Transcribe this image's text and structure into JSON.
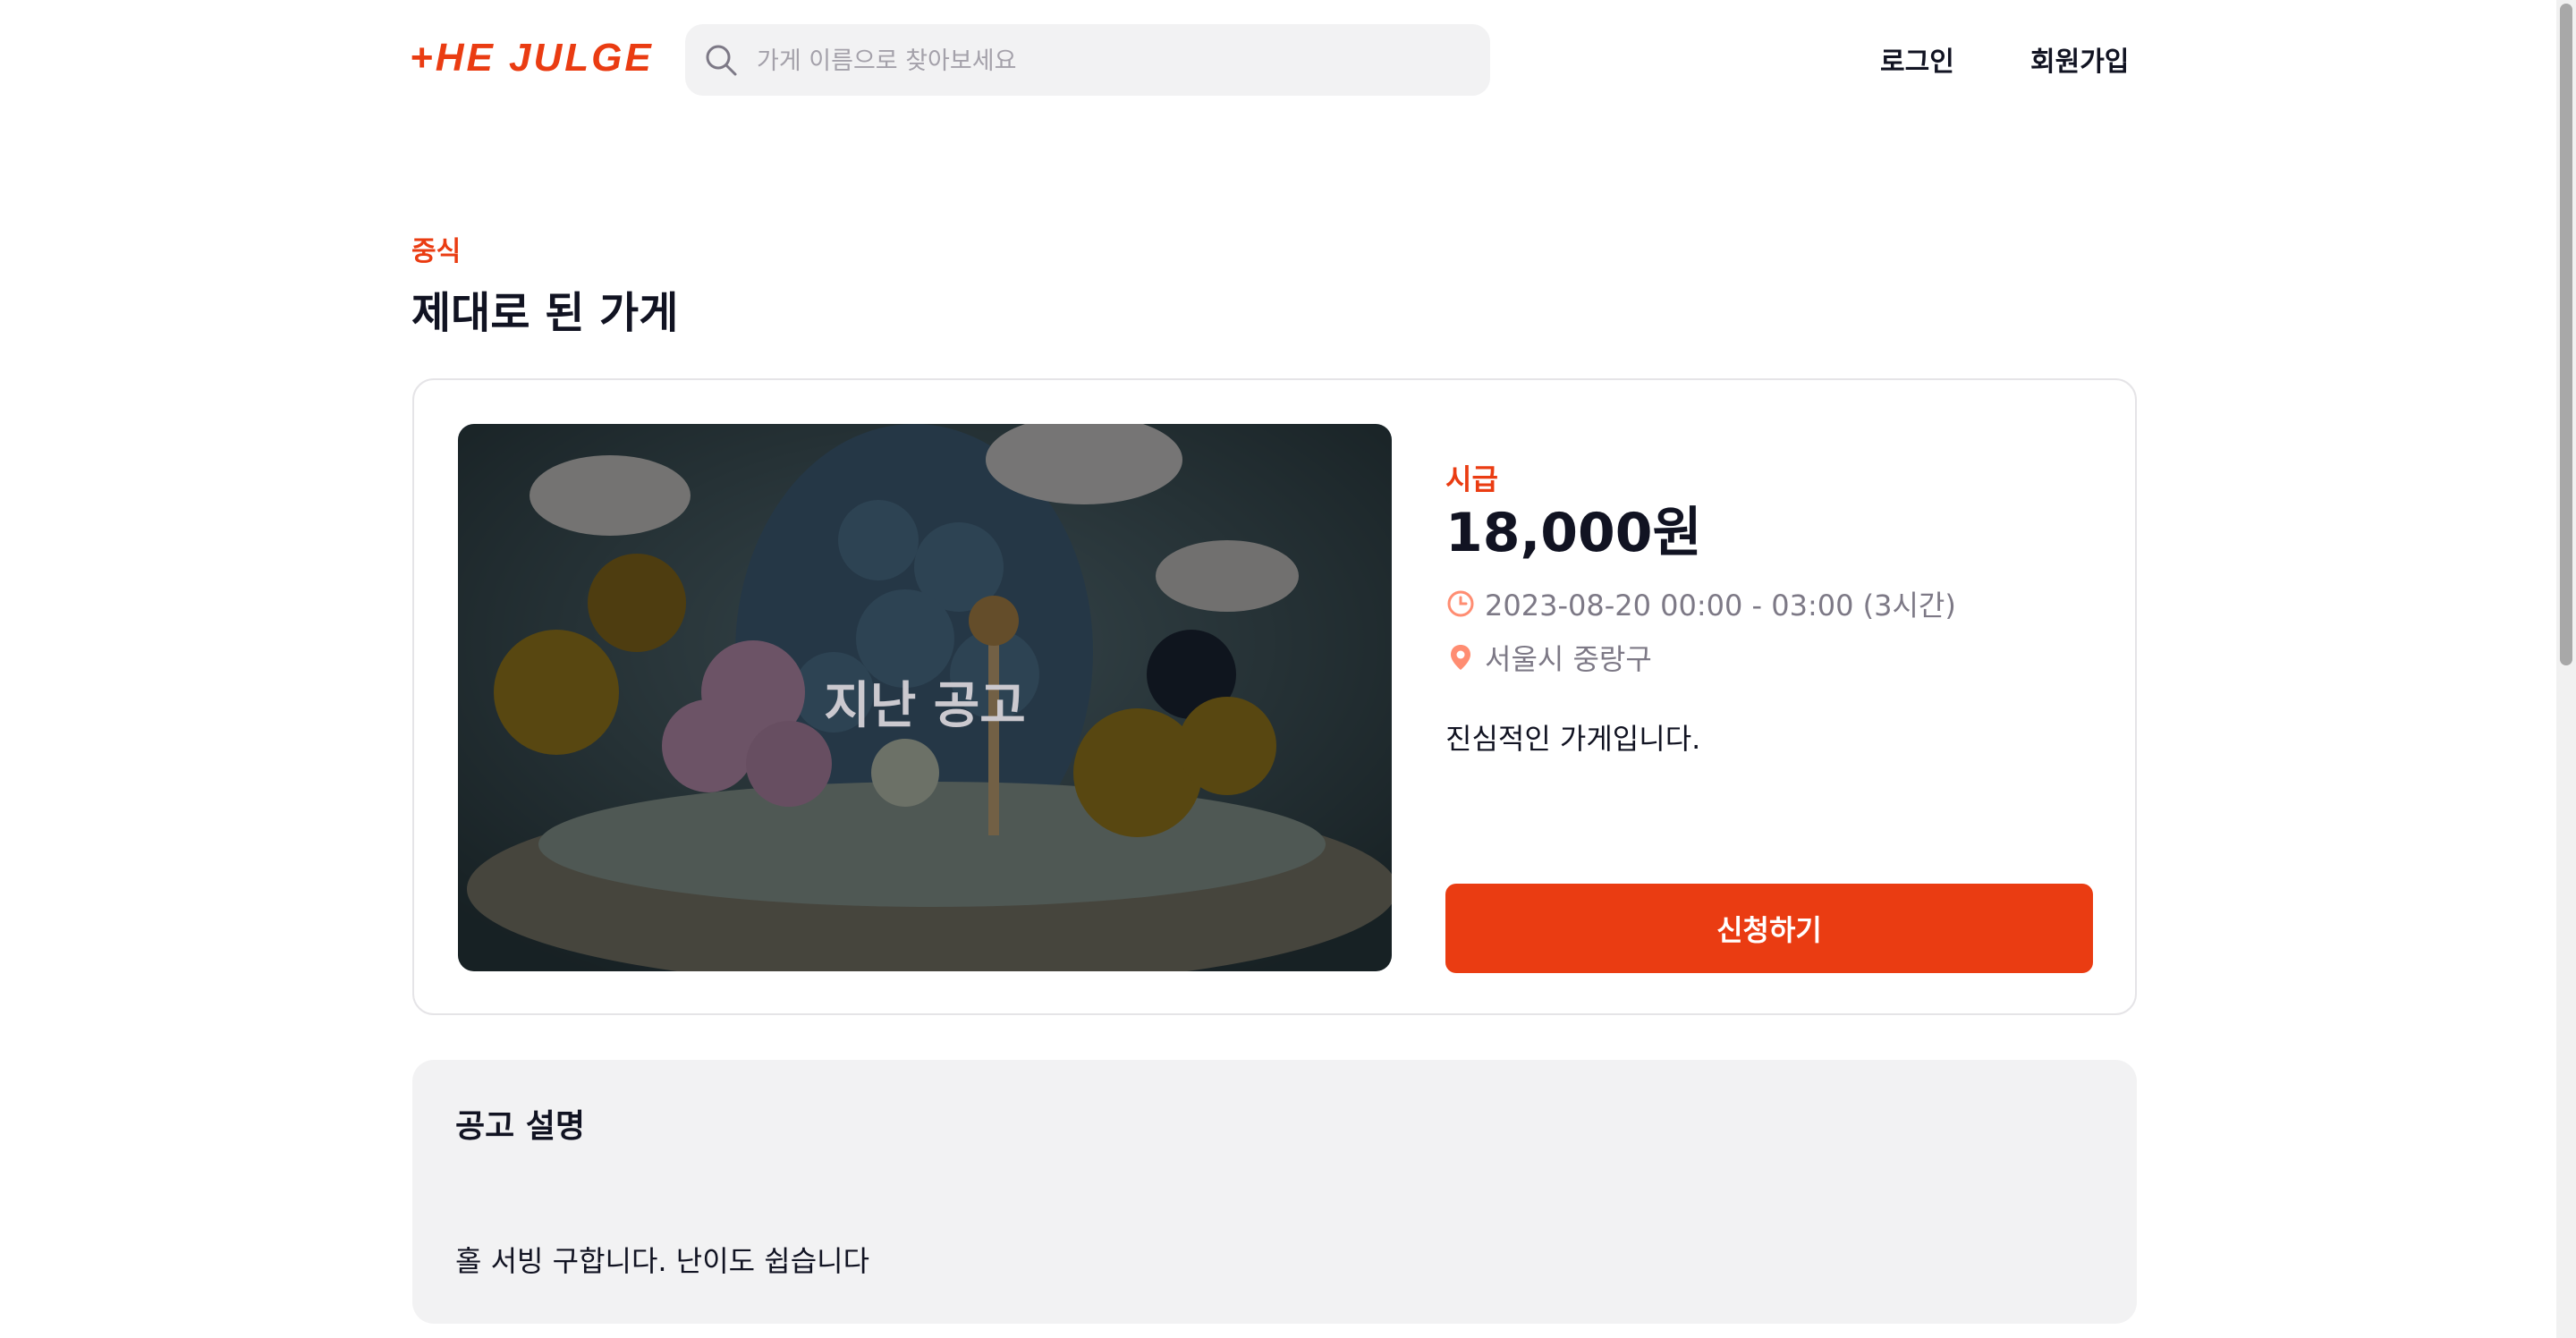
{
  "header": {
    "logo": "+HE JULGE",
    "search_placeholder": "가게 이름으로 찾아보세요",
    "search_value": "",
    "login_label": "로그인",
    "signup_label": "회원가입"
  },
  "shop": {
    "category": "중식",
    "name": "제대로 된 가게"
  },
  "notice": {
    "image_overlay_label": "지난 공고",
    "wage_label": "시급",
    "wage": "18,000원",
    "time": "2023-08-20 00:00 - 03:00 (3시간)",
    "location": "서울시 중랑구",
    "shop_description": "진심적인 가게입니다.",
    "apply_label": "신청하기"
  },
  "description_card": {
    "title": "공고 설명",
    "body": "홀 서빙 구합니다. 난이도 쉽습니다"
  },
  "colors": {
    "accent": "#ea3c12",
    "text": "#111322",
    "muted": "#7d7986",
    "panel": "#f2f2f3"
  },
  "icons": {
    "search": "search-icon",
    "clock": "clock-icon",
    "location": "location-pin-icon"
  }
}
